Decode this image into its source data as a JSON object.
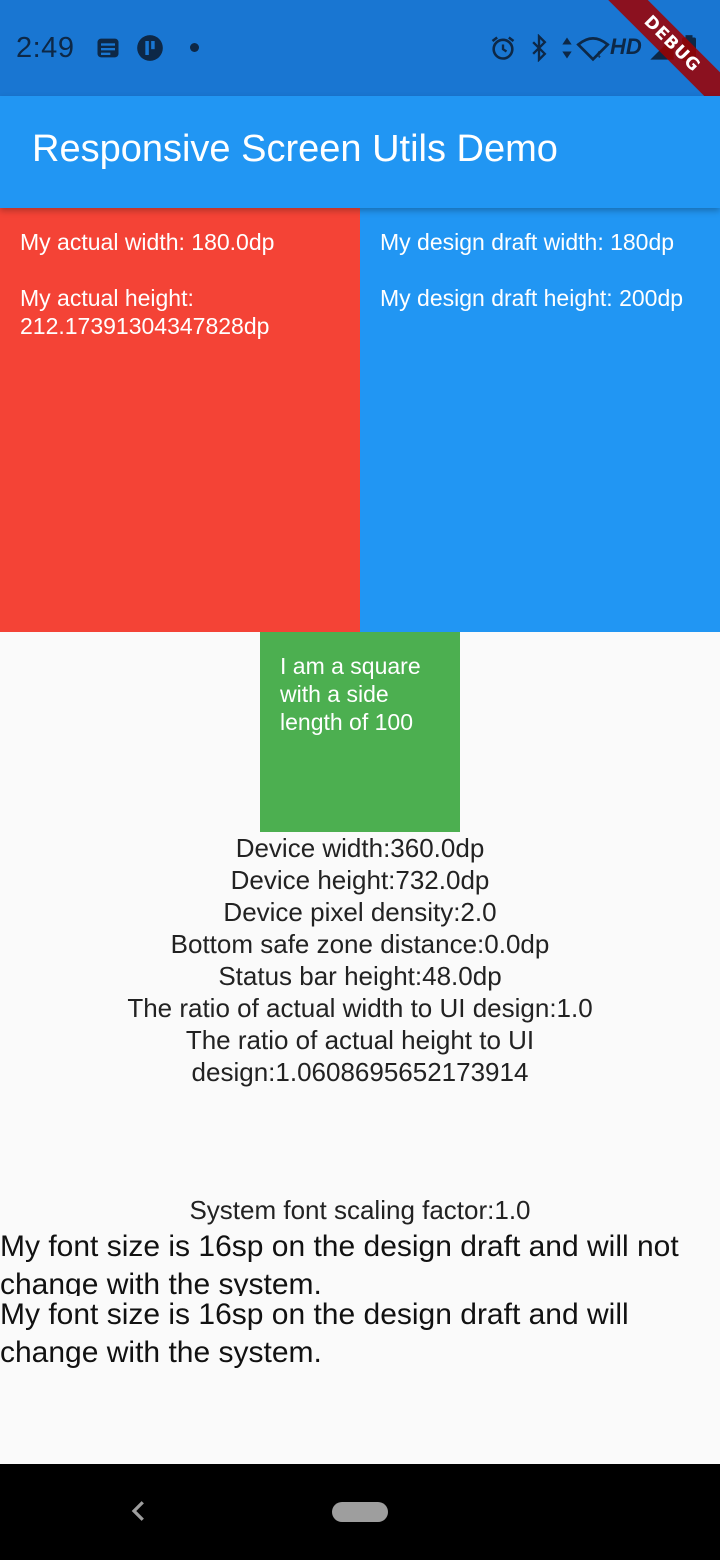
{
  "status_bar": {
    "time": "2:49",
    "hd_label": "HD",
    "icons": [
      "notification-icon",
      "app-p-icon",
      "dot-icon",
      "alarm-icon",
      "bluetooth-icon",
      "data-arrows-icon",
      "wifi-icon",
      "signal-icon",
      "battery-icon"
    ],
    "colors": {
      "background": "#1976d2",
      "foreground": "#0d2847"
    }
  },
  "debug_banner": {
    "label": "DEBUG"
  },
  "app_bar": {
    "title": "Responsive Screen Utils Demo",
    "color": "#2196f3"
  },
  "red_box": {
    "width_text": "My actual width: 180.0dp",
    "height_text": "My actual height: 212.17391304347828dp",
    "color": "#f44336"
  },
  "blue_box": {
    "width_text": "My design draft width: 180dp",
    "height_text": "My design draft height: 200dp",
    "color": "#2196f3"
  },
  "green_box": {
    "text": "I am a square with a side length of 100",
    "color": "#4caf50"
  },
  "device_info": {
    "width": "Device width:360.0dp",
    "height": "Device height:732.0dp",
    "density": "Device pixel density:2.0",
    "bottom_safe": "Bottom safe zone distance:0.0dp",
    "status_bar_height": "Status bar height:48.0dp",
    "width_ratio": "The ratio of actual width to UI design:1.0",
    "height_ratio": "The ratio of actual height to UI design:1.0608695652173914"
  },
  "font_scaling": "System font scaling factor:1.0",
  "font_fixed_text": "My font size is 16sp on the design draft and will not change with the system.",
  "font_scaled_text": "My font size is 16sp on the design draft and will change with the system.",
  "nav_bar": {
    "icons": [
      "back-icon",
      "home-pill-icon"
    ]
  }
}
